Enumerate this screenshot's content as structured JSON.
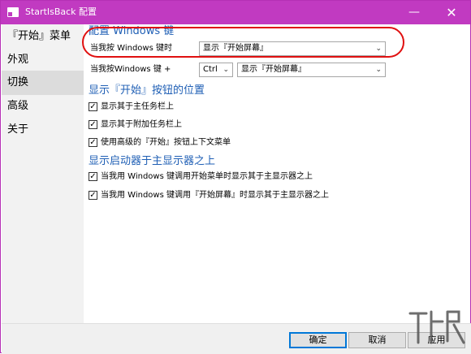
{
  "window": {
    "title": "StartIsBack 配置",
    "minimize_glyph": "—",
    "close_glyph": "✕"
  },
  "sidebar": {
    "items": [
      {
        "label": "『开始』菜单",
        "active": false
      },
      {
        "label": "外观",
        "active": false
      },
      {
        "label": "切换",
        "active": true
      },
      {
        "label": "高级",
        "active": false
      },
      {
        "label": "关于",
        "active": false
      }
    ]
  },
  "content": {
    "section1": {
      "title": "配置 Windows 键",
      "row1": {
        "label": "当我按 Windows 键时",
        "value": "显示『开始屏幕』"
      },
      "row2": {
        "label": "当我按Windows 键 +",
        "modifier": "Ctrl",
        "value": "显示『开始屏幕』"
      }
    },
    "section2": {
      "title": "显示『开始』按钮的位置",
      "checks": [
        {
          "label": "显示其于主任务栏上",
          "checked": true
        },
        {
          "label": "显示其于附加任务栏上",
          "checked": true
        },
        {
          "label": "使用高级的『开始』按钮上下文菜单",
          "checked": true
        }
      ]
    },
    "section3": {
      "title": "显示启动器于主显示器之上",
      "checks": [
        {
          "label": "当我用 Windows 键调用开始菜单时显示其于主显示器之上",
          "checked": true
        },
        {
          "label": "当我用 Windows 键调用『开始屏幕』时显示其于主显示器之上",
          "checked": true
        }
      ]
    }
  },
  "footer": {
    "ok_label": "确定",
    "cancel_label": "取消",
    "apply_label": "应用"
  },
  "icons": {
    "dropdown_arrow": "⌄",
    "check_mark": "✓"
  },
  "colors": {
    "titlebar": "#c13ac1",
    "section_title": "#1f5fb5",
    "annotation": "#e01010",
    "default_button_border": "#0078d7"
  }
}
